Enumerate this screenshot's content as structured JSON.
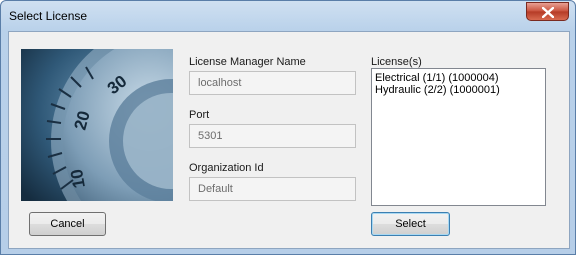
{
  "window": {
    "title": "Select License"
  },
  "fields": {
    "license_manager_label": "License Manager Name",
    "license_manager_value": "localhost",
    "port_label": "Port",
    "port_value": "5301",
    "org_label": "Organization Id",
    "org_value": "Default"
  },
  "licenses": {
    "label": "License(s)",
    "items": [
      "Electrical (1/1) (1000004)",
      "Hydraulic (2/2) (1000001)"
    ]
  },
  "buttons": {
    "cancel": "Cancel",
    "select": "Select"
  },
  "dial_numbers": [
    "30",
    "20",
    "10"
  ],
  "colors": {
    "title_bar": "#b9d1ea",
    "close_button": "#c8503a",
    "default_button_border": "#3c7fb1"
  }
}
